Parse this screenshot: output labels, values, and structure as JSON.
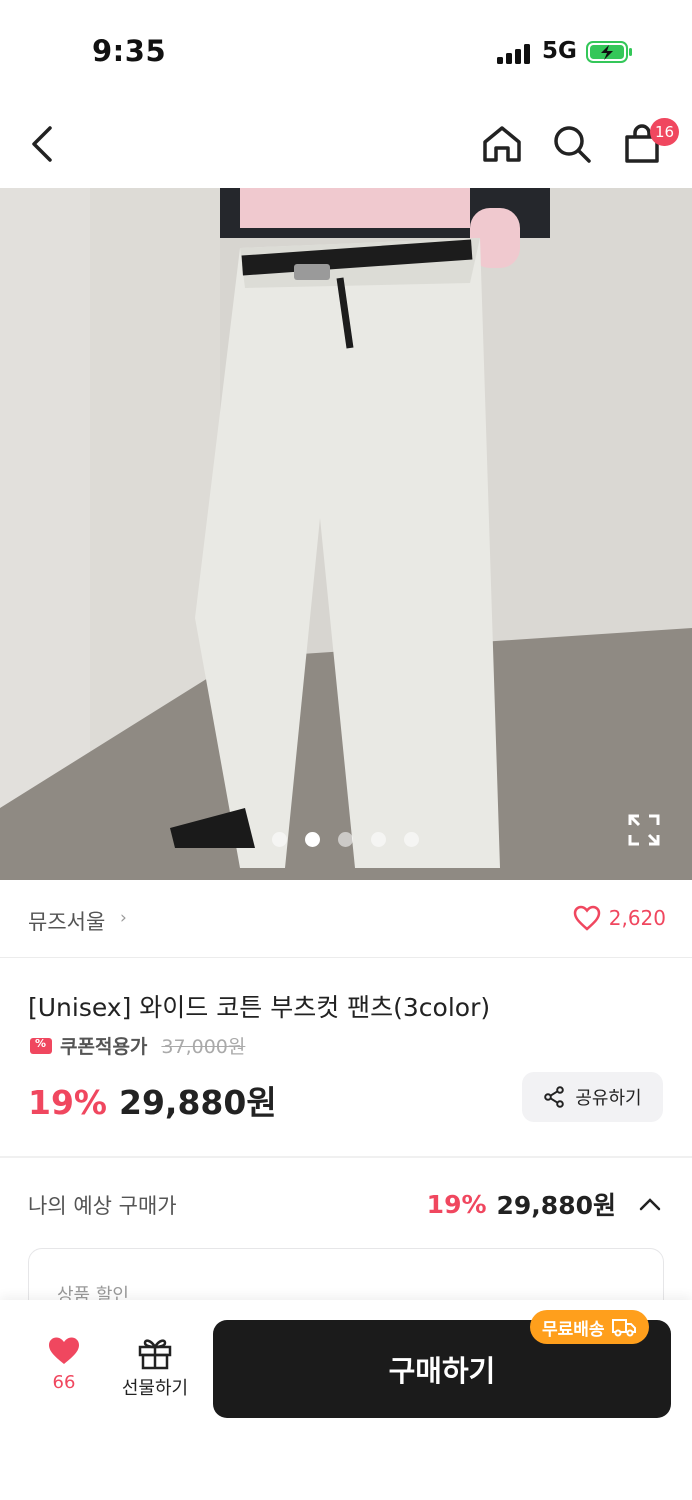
{
  "status_bar": {
    "time": "9:35",
    "network": "5G"
  },
  "nav": {
    "cart_count": "16"
  },
  "gallery": {
    "page_count": 5,
    "active_index": 1
  },
  "brand": {
    "name": "뮤즈서울",
    "chevron": "›",
    "like_count": "2,620"
  },
  "product": {
    "title": "[Unisex] 와이드 코튼 부츠컷 팬츠(3color)",
    "coupon_label": "쿠폰적용가",
    "original_price": "37,000원",
    "discount": "19%",
    "price": "29,880원",
    "share_label": "공유하기"
  },
  "expected_price": {
    "label": "나의 예상 구매가",
    "discount": "19%",
    "price": "29,880원",
    "detail_label": "상품 할인"
  },
  "bottom_bar": {
    "heart_count": "66",
    "gift_label": "선물하기",
    "buy_label": "구매하기",
    "shipping_badge": "무료배송"
  },
  "colors": {
    "accent": "#f0475f",
    "buy_button": "#1b1b1b",
    "shipping_badge": "#ff9f1c"
  },
  "icons": [
    "back-icon",
    "home-icon",
    "search-icon",
    "cart-icon",
    "expand-icon",
    "heart-icon",
    "coupon-icon",
    "share-icon",
    "chevron-up-icon",
    "gift-icon",
    "truck-icon"
  ]
}
